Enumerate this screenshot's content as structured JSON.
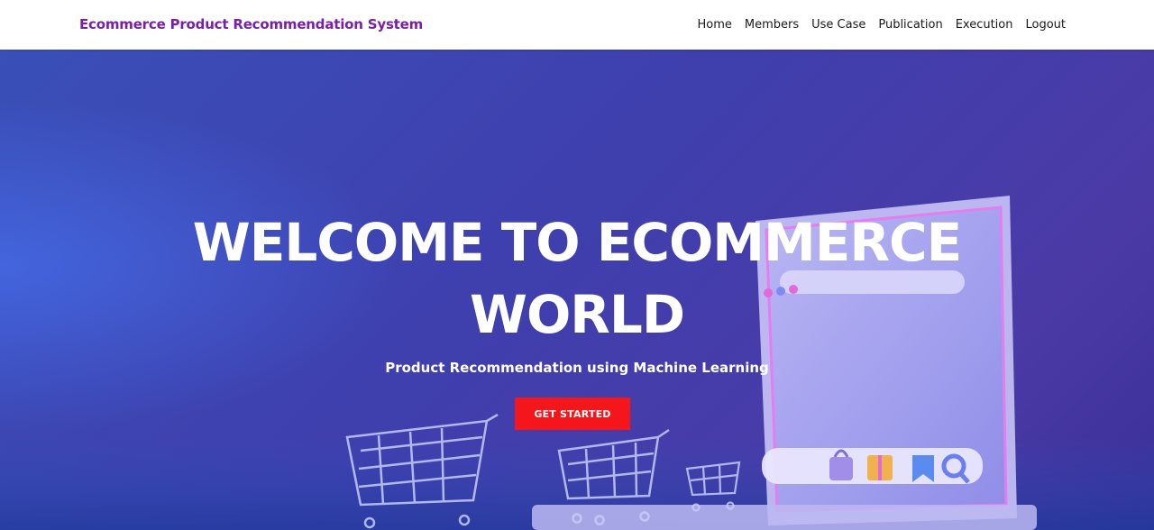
{
  "nav": {
    "brand": "Ecommerce Product Recommendation System",
    "links": [
      "Home",
      "Members",
      "Use Case",
      "Publication",
      "Execution",
      "Logout"
    ]
  },
  "hero": {
    "title_line1": "WELCOME TO ECOMMERCE",
    "title_line2": "WORLD",
    "subtitle": "Product Recommendation using Machine Learning",
    "cta_label": "GET STARTED"
  },
  "colors": {
    "brand": "#7a1fa8",
    "cta": "#f5161b",
    "hero_bg": "#3f3fae",
    "nav_bg": "#ffffff"
  },
  "icons": [
    "shopping-cart-icon",
    "laptop-illustration",
    "shopping-bag-icon",
    "gift-icon",
    "bookmark-icon",
    "search-icon"
  ]
}
